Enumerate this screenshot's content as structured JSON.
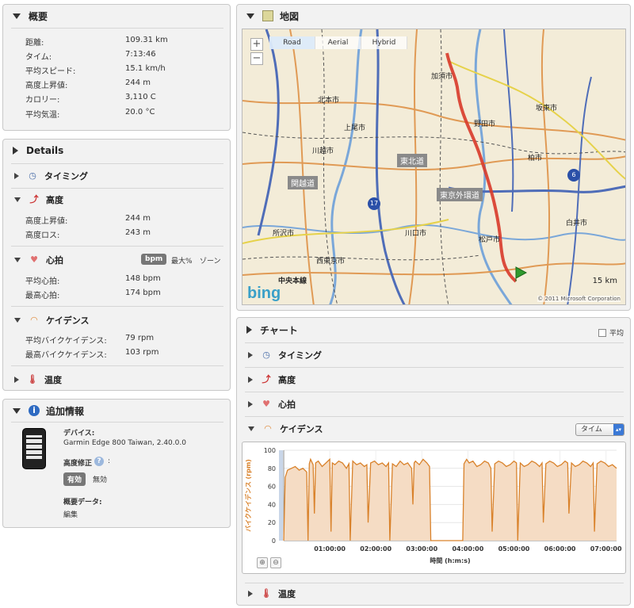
{
  "overview": {
    "title": "概要",
    "rows": [
      {
        "label": "距離:",
        "value": "109.31 km"
      },
      {
        "label": "タイム:",
        "value": "7:13:46"
      },
      {
        "label": "平均スピード:",
        "value": "15.1 km/h"
      },
      {
        "label": "高度上昇値:",
        "value": "244 m"
      },
      {
        "label": "カロリー:",
        "value": "3,110 C"
      },
      {
        "label": "平均気温:",
        "value": "20.0 °C"
      }
    ]
  },
  "details": {
    "title": "Details",
    "timing": "タイミング",
    "altitude": {
      "title": "高度",
      "rows": [
        {
          "label": "高度上昇値:",
          "value": "244 m"
        },
        {
          "label": "高度ロス:",
          "value": "243 m"
        }
      ]
    },
    "heart": {
      "title": "心拍",
      "unit_bpm": "bpm",
      "unit_pct": "最大%",
      "unit_zone": "ゾーン",
      "rows": [
        {
          "label": "平均心拍:",
          "value": "148 bpm"
        },
        {
          "label": "最高心拍:",
          "value": "174 bpm"
        }
      ]
    },
    "cadence": {
      "title": "ケイデンス",
      "rows": [
        {
          "label": "平均バイクケイデンス:",
          "value": "79 rpm"
        },
        {
          "label": "最高バイクケイデンス:",
          "value": "103 rpm"
        }
      ]
    },
    "temperature": "温度"
  },
  "extra": {
    "title": "追加情報",
    "device_label": "デバイス:",
    "device_value": "Garmin Edge 800 Taiwan, 2.40.0.0",
    "altcorr_label": "高度修正",
    "altcorr_colon": ":",
    "enabled": "有効",
    "disabled": "無効",
    "summary_label": "概要データ:",
    "edit": "編集"
  },
  "map": {
    "title": "地図",
    "modes": [
      "Road",
      "Aerial",
      "Hybrid"
    ],
    "zoom_in": "+",
    "zoom_out": "−",
    "scale": "15 km",
    "bing": "bing",
    "copyright": "© 2011 Microsoft Corporation",
    "places": {
      "kanto": "関越道",
      "tohoku": "東北道",
      "gaikan": "東京外環道",
      "chuo": "中央本線",
      "noda": "野田市",
      "kawagoe": "川越市",
      "matsudo": "松戸市",
      "kashiwa": "柏市",
      "ageo": "上尾市",
      "nishitokyo": "西東京市",
      "kawaguchi": "川口市",
      "shiroi": "白井市",
      "tokorozawa": "所沢市",
      "kitamoto": "北本市",
      "kazo": "加須市",
      "bando": "坂東市"
    },
    "route_sign_17": "17",
    "route_sign_6": "6"
  },
  "chart": {
    "title": "チャート",
    "avg_label": "平均",
    "sections": [
      "タイミング",
      "高度",
      "心拍",
      "ケイデンス"
    ],
    "select_value": "タイム",
    "temperature": "温度"
  },
  "chart_data": {
    "type": "area",
    "title": "",
    "xlabel": "時間 (h:m:s)",
    "ylabel": "バイクケイデンス (rpm)",
    "ylim": [
      0,
      100
    ],
    "yticks": [
      0,
      20,
      40,
      60,
      80,
      100
    ],
    "xticks": [
      "01:00:00",
      "02:00:00",
      "03:00:00",
      "04:00:00",
      "05:00:00",
      "06:00:00",
      "07:00:00"
    ],
    "xlim": [
      0,
      26026
    ],
    "series": [
      {
        "color": "#d9822b",
        "x": [
          0,
          120,
          300,
          600,
          900,
          1200,
          1500,
          1800,
          1900,
          2000,
          2100,
          2300,
          2400,
          2500,
          2700,
          3000,
          3300,
          3600,
          3700,
          3800,
          4000,
          4300,
          4600,
          4900,
          5100,
          5200,
          5400,
          5700,
          6000,
          6300,
          6500,
          6600,
          6800,
          7100,
          7400,
          7700,
          8000,
          8200,
          8300,
          8500,
          8800,
          9100,
          9400,
          9700,
          10000,
          10100,
          10200,
          10300,
          10600,
          10900,
          11200,
          11400,
          11500,
          11700,
          14000,
          14100,
          14300,
          14500,
          14800,
          15100,
          15400,
          15700,
          16000,
          16200,
          16300,
          16500,
          16800,
          17100,
          17400,
          17700,
          18000,
          18200,
          18300,
          18500,
          18800,
          19100,
          19400,
          19700,
          20000,
          20200,
          20300,
          20500,
          20800,
          21100,
          21400,
          21700,
          22000,
          22200,
          22300,
          22500,
          22800,
          23100,
          23400,
          23700,
          24000,
          24200,
          24300,
          24500,
          24800,
          25100,
          25400,
          25700,
          26026
        ],
        "y": [
          0,
          70,
          78,
          80,
          82,
          78,
          80,
          76,
          0,
          85,
          90,
          84,
          30,
          86,
          88,
          82,
          86,
          90,
          10,
          86,
          84,
          88,
          86,
          80,
          85,
          0,
          88,
          84,
          86,
          82,
          84,
          20,
          86,
          88,
          84,
          86,
          82,
          86,
          0,
          85,
          82,
          88,
          84,
          86,
          80,
          40,
          86,
          88,
          84,
          90,
          86,
          82,
          0,
          0,
          0,
          85,
          90,
          86,
          88,
          82,
          84,
          88,
          86,
          80,
          10,
          85,
          88,
          86,
          82,
          84,
          88,
          86,
          0,
          86,
          82,
          84,
          88,
          86,
          82,
          86,
          20,
          85,
          88,
          86,
          82,
          84,
          88,
          86,
          30,
          86,
          82,
          84,
          88,
          86,
          82,
          86,
          10,
          85,
          88,
          86,
          82,
          84,
          80
        ]
      }
    ]
  }
}
